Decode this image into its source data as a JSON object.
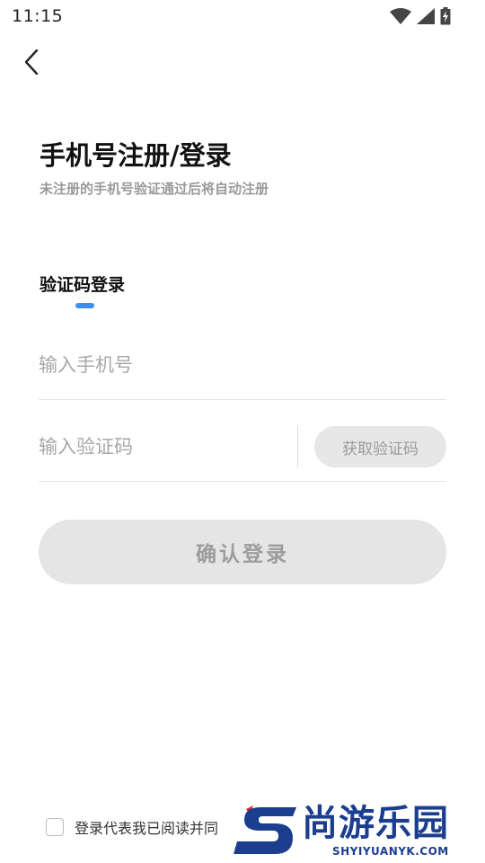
{
  "status_bar": {
    "time": "11:15",
    "icons": [
      "wifi-icon",
      "cellular-signal-icon",
      "battery-charging-icon"
    ]
  },
  "header": {
    "back_icon": "chevron-left-icon"
  },
  "main": {
    "title": "手机号注册/登录",
    "subtitle": "未注册的手机号验证通过后将自动注册",
    "tab_label": "验证码登录",
    "phone_placeholder": "输入手机号",
    "phone_value": "",
    "code_placeholder": "输入验证码",
    "code_value": "",
    "get_code_label": "获取验证码",
    "confirm_label": "确认登录"
  },
  "agreement": {
    "text": "登录代表我已阅读并同",
    "checked": false
  },
  "watermark": {
    "brand": "尚游乐园",
    "url": "SHYIYUANYK.COM"
  },
  "colors": {
    "accent": "#3d8df5",
    "button_bg": "#e5e5e5",
    "button_text": "#9c9c9c",
    "subtitle_text": "#9a9a9a",
    "watermark_blue": "#1b3e8f",
    "watermark_red": "#e5262b"
  }
}
